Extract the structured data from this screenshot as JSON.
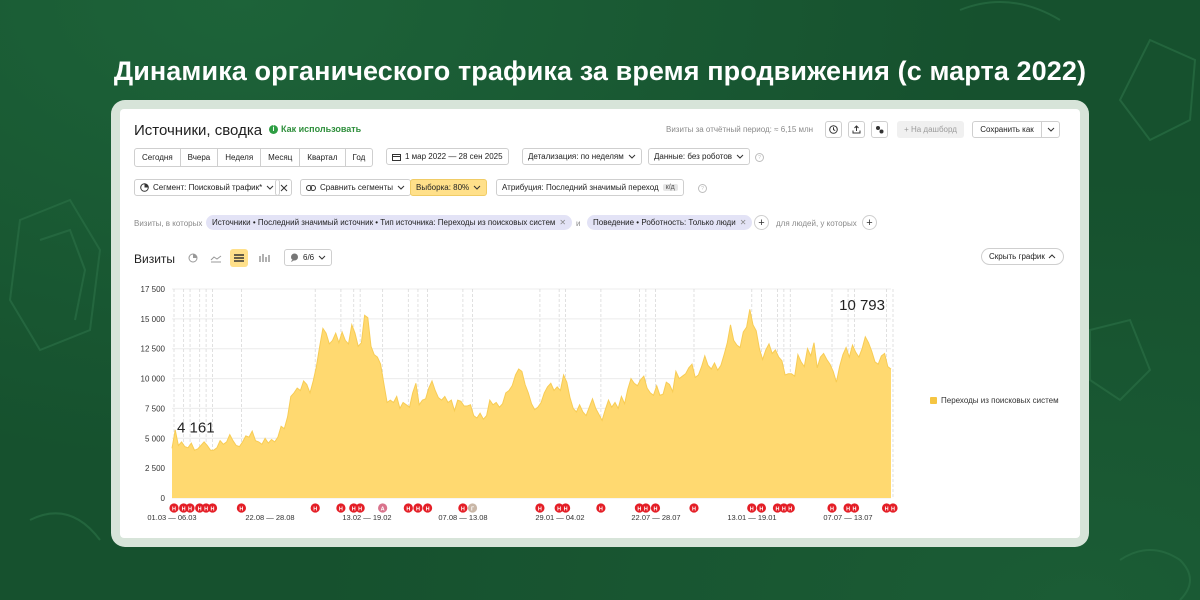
{
  "headline": "Динамика органического трафика за время продвижения (с марта 2022)",
  "colors": {
    "bg": "#16512e",
    "accent": "#f5c542",
    "area": "#ffd970",
    "marker": "#e41e26",
    "chip": "#e3e3f6"
  },
  "report": {
    "title": "Источники, сводка",
    "howto": "Как использовать",
    "visits_info": "Визиты за отчётный период: ≈ 6,15 млн",
    "icons": [
      "clock-icon",
      "export-icon",
      "settings-icon"
    ],
    "to_dashboard": "+ На дашборд",
    "save_as": "Сохранить как"
  },
  "toolbar": {
    "periods": [
      "Сегодня",
      "Вчера",
      "Неделя",
      "Месяц",
      "Квартал",
      "Год"
    ],
    "date_range": "1 мар 2022 — 28 сен 2025",
    "detail": "Детализация: по неделям",
    "data": "Данные: без роботов"
  },
  "toolbar2": {
    "segment": "Сегмент: Поисковый трафик*",
    "compare": "Сравнить сегменты",
    "sample": "Выборка: 80%",
    "attribution": "Атрибуция: Последний значимый переход",
    "attribution_badge": "к/д"
  },
  "filters": {
    "prefix": "Визиты, в которых",
    "chip1": "Источники • Последний значимый источник • Тип источника: Переходы из поисковых систем",
    "and": "и",
    "chip2": "Поведение • Роботность: Только люди",
    "suffix": "для людей, у которых"
  },
  "chart_head": {
    "title": "Визиты",
    "metrics": "6/6",
    "hide": "Скрыть график"
  },
  "chart_data": {
    "type": "area",
    "ylim": [
      0,
      17500
    ],
    "yticks": [
      "17 500",
      "15 000",
      "12 500",
      "10 000",
      "7 500",
      "5 000",
      "2 500",
      "0"
    ],
    "xticks": [
      "01.03 — 06.03",
      "22.08 — 28.08",
      "13.02 — 19.02",
      "07.08 — 13.08",
      "29.01 — 04.02",
      "22.07 — 28.07",
      "13.01 — 19.01",
      "07.07 — 13.07"
    ],
    "first_label": "4 161",
    "last_label": "10 793",
    "series": [
      {
        "name": "Переходы из поисковых систем",
        "values": [
          4161,
          5700,
          4400,
          4700,
          4300,
          4200,
          4600,
          4000,
          4100,
          4400,
          4700,
          4400,
          4000,
          4000,
          4200,
          4800,
          4500,
          4700,
          5300,
          4800,
          4400,
          4300,
          4700,
          5200,
          5100,
          5600,
          4800,
          4700,
          4500,
          5000,
          4600,
          4900,
          4700,
          5100,
          6000,
          5800,
          6800,
          8500,
          8800,
          9200,
          9000,
          9800,
          9500,
          8800,
          9800,
          11000,
          12700,
          14200,
          13800,
          12900,
          13200,
          13800,
          13000,
          13900,
          13200,
          12900,
          14500,
          13800,
          12700,
          13000,
          15300,
          15100,
          12700,
          12000,
          11800,
          11200,
          9600,
          8000,
          8200,
          8000,
          8500,
          7500,
          8000,
          7800,
          7600,
          8800,
          9600,
          7800,
          8200,
          8300,
          9200,
          9800,
          9000,
          8400,
          8200,
          8500,
          8000,
          8200,
          7300,
          8200,
          8100,
          7700,
          7700,
          7800,
          6900,
          6700,
          7100,
          6600,
          6900,
          8200,
          7800,
          8000,
          7600,
          7900,
          8800,
          9000,
          9400,
          10300,
          10800,
          10600,
          9500,
          8800,
          7900,
          7400,
          7600,
          8000,
          8800,
          9300,
          9600,
          9000,
          9300,
          9000,
          10300,
          9700,
          8400,
          7500,
          7200,
          7800,
          7200,
          6900,
          7600,
          8300,
          7500,
          7000,
          6500,
          7400,
          8200,
          7600,
          8000,
          7500,
          8500,
          7900,
          9100,
          10000,
          9600,
          9400,
          9900,
          10200,
          9200,
          8800,
          8600,
          9400,
          8600,
          8700,
          9700,
          9500,
          8900,
          10600,
          10000,
          10200,
          10400,
          10900,
          11200,
          10100,
          10300,
          11000,
          11900,
          11100,
          10800,
          11300,
          10700,
          11100,
          12000,
          13000,
          14500,
          13200,
          12800,
          12600,
          13900,
          14300,
          15800,
          14500,
          14000,
          12500,
          11600,
          12400,
          12900,
          12100,
          12400,
          11800,
          11500,
          10300,
          10400,
          10400,
          10200,
          12000,
          11400,
          11000,
          12500,
          11900,
          13000,
          10900,
          11800,
          12100,
          11600,
          11200,
          10600,
          9700,
          11000,
          12000,
          12600,
          11800,
          12800,
          12200,
          11800,
          12500,
          13500,
          13000,
          12300,
          11400,
          11200,
          11900,
          12100,
          11000,
          10793
        ]
      }
    ],
    "markers": [
      {
        "i": 0,
        "s": "Н"
      },
      {
        "i": 3,
        "s": "Н"
      },
      {
        "i": 5,
        "s": "Н"
      },
      {
        "i": 8,
        "s": "Н"
      },
      {
        "i": 10,
        "s": "Н"
      },
      {
        "i": 12,
        "s": "Н"
      },
      {
        "i": 21,
        "s": "Н"
      },
      {
        "i": 44,
        "s": "Н"
      },
      {
        "i": 52,
        "s": "Н"
      },
      {
        "i": 56,
        "s": "Н"
      },
      {
        "i": 58,
        "s": "Н"
      },
      {
        "i": 65,
        "s": "А"
      },
      {
        "i": 73,
        "s": "Н"
      },
      {
        "i": 76,
        "s": "Н"
      },
      {
        "i": 79,
        "s": "Н"
      },
      {
        "i": 90,
        "s": "Н"
      },
      {
        "i": 93,
        "s": "Г"
      },
      {
        "i": 114,
        "s": "Н"
      },
      {
        "i": 120,
        "s": "Н"
      },
      {
        "i": 122,
        "s": "Н"
      },
      {
        "i": 133,
        "s": "Н"
      },
      {
        "i": 145,
        "s": "Н"
      },
      {
        "i": 147,
        "s": "Н"
      },
      {
        "i": 150,
        "s": "Н"
      },
      {
        "i": 162,
        "s": "Н"
      },
      {
        "i": 180,
        "s": "Н"
      },
      {
        "i": 183,
        "s": "Н"
      },
      {
        "i": 188,
        "s": "Н"
      },
      {
        "i": 190,
        "s": "Н"
      },
      {
        "i": 192,
        "s": "Н"
      },
      {
        "i": 205,
        "s": "Н"
      },
      {
        "i": 210,
        "s": "Н"
      },
      {
        "i": 212,
        "s": "Н"
      },
      {
        "i": 222,
        "s": "Н"
      },
      {
        "i": 224,
        "s": "Н"
      }
    ],
    "grid": true,
    "legend": "right"
  }
}
